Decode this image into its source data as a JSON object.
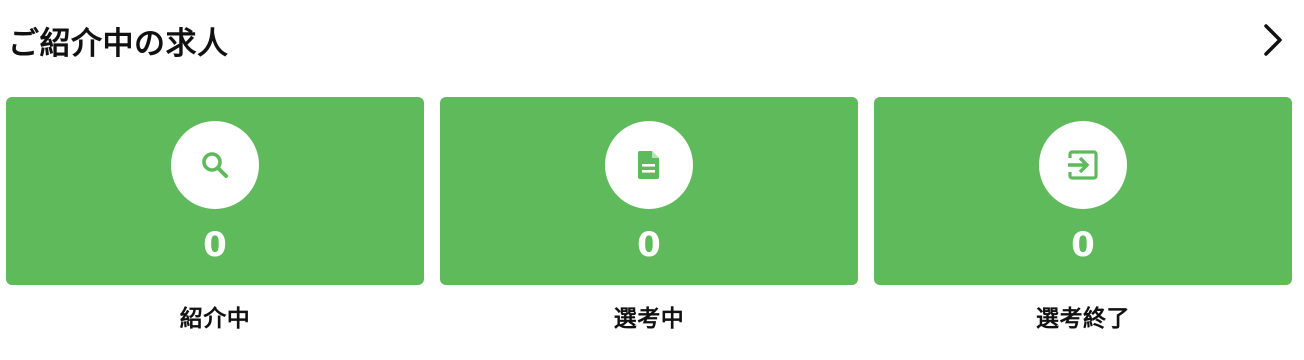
{
  "header": {
    "title": "ご紹介中の求人",
    "more_icon": "chevron-right-icon"
  },
  "colors": {
    "card_background": "#5fba5c",
    "icon_circle": "#ffffff",
    "icon": "#5fba5c",
    "text": "#111111"
  },
  "cards": [
    {
      "label": "紹介中",
      "count": "0",
      "icon": "search-icon"
    },
    {
      "label": "選考中",
      "count": "0",
      "icon": "document-icon"
    },
    {
      "label": "選考終了",
      "count": "0",
      "icon": "exit-icon"
    }
  ]
}
